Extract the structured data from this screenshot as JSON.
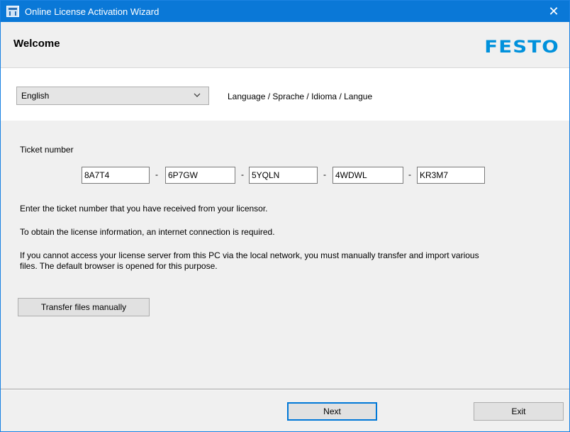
{
  "window": {
    "title": "Online License Activation Wizard",
    "close_glyph": "✕"
  },
  "header": {
    "title": "Welcome",
    "logo_text": "FESTO",
    "logo_color": "#0091dc"
  },
  "language": {
    "selected": "English",
    "caption": "Language / Sprache / Idioma / Langue"
  },
  "ticket": {
    "label": "Ticket number",
    "separator": "-",
    "parts": [
      "8A7T4",
      "6P7GW",
      "5YQLN",
      "4WDWL",
      "KR3M7"
    ]
  },
  "info": {
    "line1": "Enter the ticket number that you have received from your licensor.",
    "line2": "To obtain the license information, an internet connection is required.",
    "line3a": "If you cannot access your license server from this PC via the local network, you must manually transfer and import various",
    "line3b": "files. The default browser is opened for this purpose."
  },
  "buttons": {
    "transfer": "Transfer files manually",
    "next": "Next",
    "exit": "Exit"
  },
  "colors": {
    "titlebar": "#0a78d7",
    "accent": "#0078d7"
  }
}
